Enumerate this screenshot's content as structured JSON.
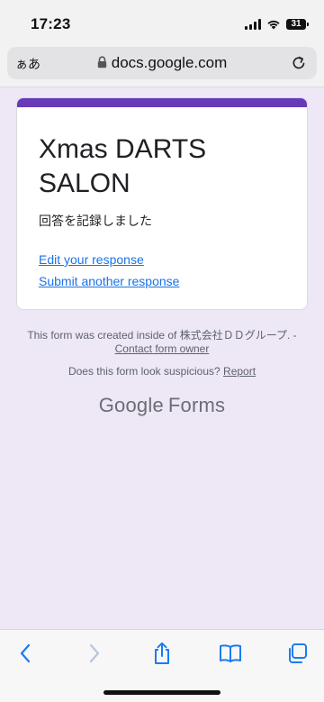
{
  "status_bar": {
    "time": "17:23",
    "battery": "31"
  },
  "browser": {
    "text_size_label": "ぁあ",
    "domain": "docs.google.com"
  },
  "form": {
    "title": "Xmas DARTS SALON",
    "confirmation": "回答を記録しました",
    "edit_link": "Edit your response",
    "submit_another_link": "Submit another response",
    "accent_color": "#673ab7"
  },
  "footer": {
    "created_inside": "This form was created inside of 株式会社ＤＤグループ. -",
    "contact_owner": "Contact form owner",
    "suspicious": "Does this form look suspicious?",
    "report": "Report",
    "logo_google": "Google",
    "logo_forms": "Forms"
  },
  "toolbar": {
    "items": [
      "back-icon",
      "forward-icon",
      "share-icon",
      "bookmarks-icon",
      "tabs-icon"
    ]
  }
}
